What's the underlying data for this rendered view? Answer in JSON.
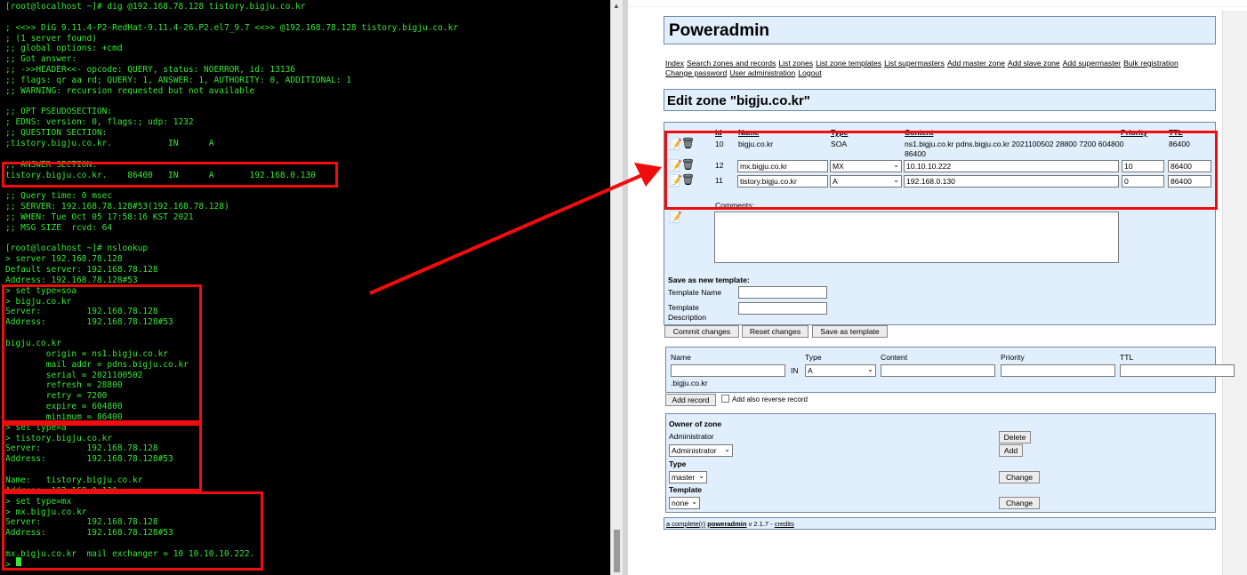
{
  "terminal": {
    "lines": [
      "[root@localhost ~]# dig @192.168.78.128 tistory.bigju.co.kr",
      "",
      "; <<>> DiG 9.11.4-P2-RedHat-9.11.4-26.P2.el7_9.7 <<>> @192.168.78.128 tistory.bigju.co.kr",
      "; (1 server found)",
      ";; global options: +cmd",
      ";; Got answer:",
      ";; ->>HEADER<<- opcode: QUERY, status: NOERROR, id: 13136",
      ";; flags: qr aa rd; QUERY: 1, ANSWER: 1, AUTHORITY: 0, ADDITIONAL: 1",
      ";; WARNING: recursion requested but not available",
      "",
      ";; OPT PSEUDOSECTION:",
      "; EDNS: version: 0, flags:; udp: 1232",
      ";; QUESTION SECTION:",
      ";tistory.bigju.co.kr.           IN      A",
      "",
      ";; ANSWER SECTION:",
      "tistory.bigju.co.kr.    86400   IN      A       192.168.0.130",
      "",
      ";; Query time: 0 msec",
      ";; SERVER: 192.168.78.128#53(192.168.78.128)",
      ";; WHEN: Tue Oct 05 17:58:16 KST 2021",
      ";; MSG SIZE  rcvd: 64",
      "",
      "[root@localhost ~]# nslookup",
      "> server 192.168.78.128",
      "Default server: 192.168.78.128",
      "Address: 192.168.78.128#53",
      "> set type=soa",
      "> bigju.co.kr",
      "Server:         192.168.78.128",
      "Address:        192.168.78.128#53",
      "",
      "bigju.co.kr",
      "        origin = ns1.bigju.co.kr",
      "        mail addr = pdns.bigju.co.kr",
      "        serial = 2021100502",
      "        refresh = 28800",
      "        retry = 7200",
      "        expire = 604800",
      "        minimum = 86400",
      "> set type=a",
      "> tistory.bigju.co.kr",
      "Server:         192.168.78.128",
      "Address:        192.168.78.128#53",
      "",
      "Name:   tistory.bigju.co.kr",
      "Address: 192.168.0.130",
      "> set type=mx",
      "> mx.bigju.co.kr",
      "Server:         192.168.78.128",
      "Address:        192.168.78.128#53",
      "",
      "mx.bigju.co.kr  mail exchanger = 10 10.10.10.222.",
      ">"
    ]
  },
  "poweradmin": {
    "title": "Poweradmin",
    "nav": [
      "Index",
      "Search zones and records",
      "List zones",
      "List zone templates",
      "List supermasters",
      "Add master zone",
      "Add slave zone",
      "Add supermaster",
      "Bulk registration",
      "Change password",
      "User administration",
      "Logout"
    ],
    "zone_title": "Edit zone \"bigju.co.kr\"",
    "columns": {
      "id": "Id",
      "name": "Name",
      "type": "Type",
      "content": "Content",
      "priority": "Priority",
      "ttl": "TTL"
    },
    "records": [
      {
        "id": "10",
        "name": "bigju.co.kr",
        "type": "SOA",
        "content": "ns1.bigju.co.kr pdns.bigju.co.kr 2021100502 28800 7200 604800 86400",
        "priority": "",
        "ttl": "86400"
      },
      {
        "id": "12",
        "name": "mx.bigju.co.kr",
        "type": "MX",
        "content": "10.10.10.222",
        "priority": "10",
        "ttl": "86400"
      },
      {
        "id": "11",
        "name": "tistory.bigju.co.kr",
        "type": "A",
        "content": "192.168.0.130",
        "priority": "0",
        "ttl": "86400"
      }
    ],
    "comments_label": "Comments:",
    "save_template_heading": "Save as new template:",
    "template_name_label": "Template Name",
    "template_desc_label_1": "Template",
    "template_desc_label_2": "Description",
    "buttons": {
      "commit": "Commit changes",
      "reset": "Reset changes",
      "save_template": "Save as template",
      "add_record": "Add record",
      "delete": "Delete",
      "add": "Add",
      "change": "Change"
    },
    "add_record": {
      "name_label": "Name",
      "type_label": "Type",
      "content_label": "Content",
      "priority_label": "Priority",
      "ttl_label": "TTL",
      "in_label": "IN",
      "type_value": "A",
      "domain_suffix": ".bigju.co.kr",
      "reverse_label": "Add also reverse record"
    },
    "owner": {
      "heading": "Owner of zone",
      "owner_name": "Administrator",
      "owner_select": "Administrator",
      "type_heading": "Type",
      "type_value": "master",
      "template_heading": "Template",
      "template_value": "none"
    },
    "footer": {
      "a_complete": "a complete(r)",
      "brand": "poweradmin",
      "version": "v 2.1.7",
      "sep": "-",
      "credits": "credits"
    }
  }
}
